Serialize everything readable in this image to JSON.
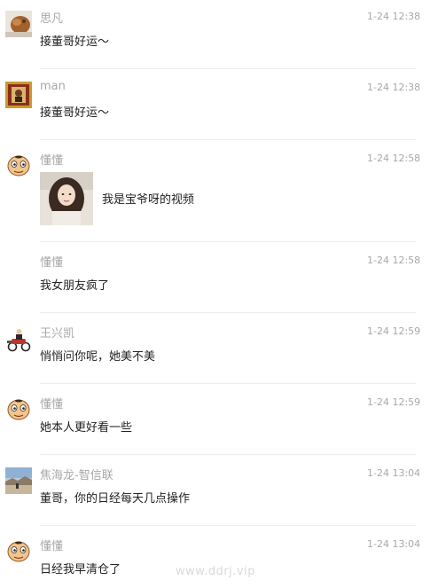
{
  "comments": [
    {
      "name": "思凡",
      "time": "1-24 12:38",
      "text": "接董哥好运～"
    },
    {
      "name": "man",
      "time": "1-24 12:38",
      "text": "接董哥好运～"
    },
    {
      "name": "懂懂",
      "time": "1-24 12:58",
      "video_title": "我是宝爷呀的视频"
    },
    {
      "name": "懂懂",
      "time": "1-24 12:58",
      "text": "我女朋友疯了"
    },
    {
      "name": "王兴凯",
      "time": "1-24 12:59",
      "text": "悄悄问你呢，她美不美"
    },
    {
      "name": "懂懂",
      "time": "1-24 12:59",
      "text": "她本人更好看一些"
    },
    {
      "name": "焦海龙-智信联",
      "time": "1-24 13:04",
      "text": "董哥，你的日经每天几点操作"
    },
    {
      "name": "懂懂",
      "time": "1-24 13:04",
      "text": "日经我早清仓了"
    }
  ],
  "watermark": "www.ddrj.vip"
}
